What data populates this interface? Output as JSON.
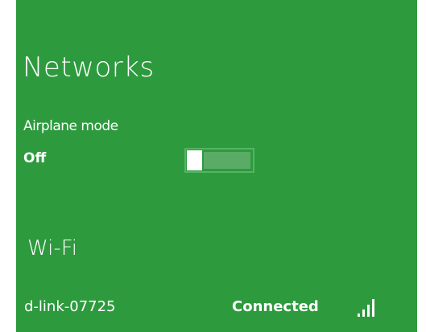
{
  "panel": {
    "title": "Networks",
    "background_color": "#2d9a3e"
  },
  "airplane_mode": {
    "label": "Airplane mode",
    "state": "Off",
    "enabled": false
  },
  "wifi": {
    "heading": "Wi-Fi",
    "networks": [
      {
        "name": "d-link-07725",
        "status": "Connected",
        "signal_icon": "signal-strength-icon",
        "signal_bars": 4
      }
    ]
  }
}
